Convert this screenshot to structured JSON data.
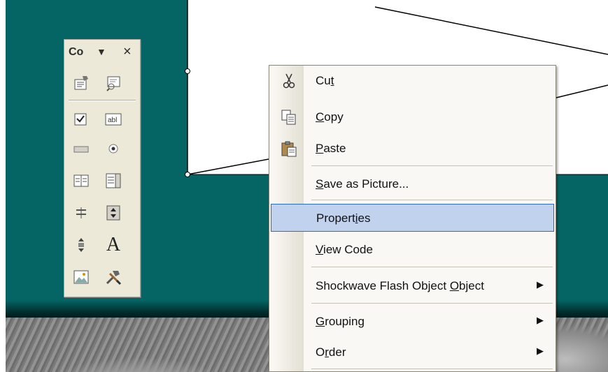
{
  "toolbox": {
    "title": "Co",
    "dropdown_glyph": "▼",
    "close_glyph": "×",
    "tools": [
      "properties-icon",
      "view-code-icon",
      "checkbox-tool-icon",
      "textbox-tool-icon",
      "command-button-tool-icon",
      "option-button-tool-icon",
      "listbox-tool-icon",
      "combobox-tool-icon",
      "toggle-button-tool-icon",
      "spin-button-tool-icon",
      "scrollbar-tool-icon",
      "label-tool-icon",
      "image-tool-icon",
      "more-controls-icon"
    ],
    "label_glyph": "A"
  },
  "context_menu": {
    "items": [
      {
        "id": "cut",
        "pre": "Cu",
        "ul": "t",
        "post": "",
        "icon": "scissors-icon"
      },
      {
        "id": "copy",
        "pre": "",
        "ul": "C",
        "post": "opy",
        "icon": "copy-icon"
      },
      {
        "id": "paste",
        "pre": "",
        "ul": "P",
        "post": "aste",
        "icon": "paste-icon"
      },
      {
        "id": "save-as-picture",
        "pre": "",
        "ul": "S",
        "post": "ave as Picture..."
      },
      {
        "id": "properties",
        "pre": "Propert",
        "ul": "i",
        "post": "es"
      },
      {
        "id": "view-code",
        "pre": "",
        "ul": "V",
        "post": "iew Code"
      },
      {
        "id": "shockwave",
        "pre": "Shockwave Flash Object ",
        "ul": "O",
        "post": "bject"
      },
      {
        "id": "grouping",
        "pre": "",
        "ul": "G",
        "post": "rouping"
      },
      {
        "id": "order",
        "pre": "O",
        "ul": "r",
        "post": "der"
      }
    ],
    "submenu_arrow": "▶"
  },
  "colors": {
    "slide_background": "#056464",
    "menu_highlight": "#c1d2ee",
    "menu_highlight_border": "#316ac5",
    "toolbox_background": "#ece9d8"
  }
}
